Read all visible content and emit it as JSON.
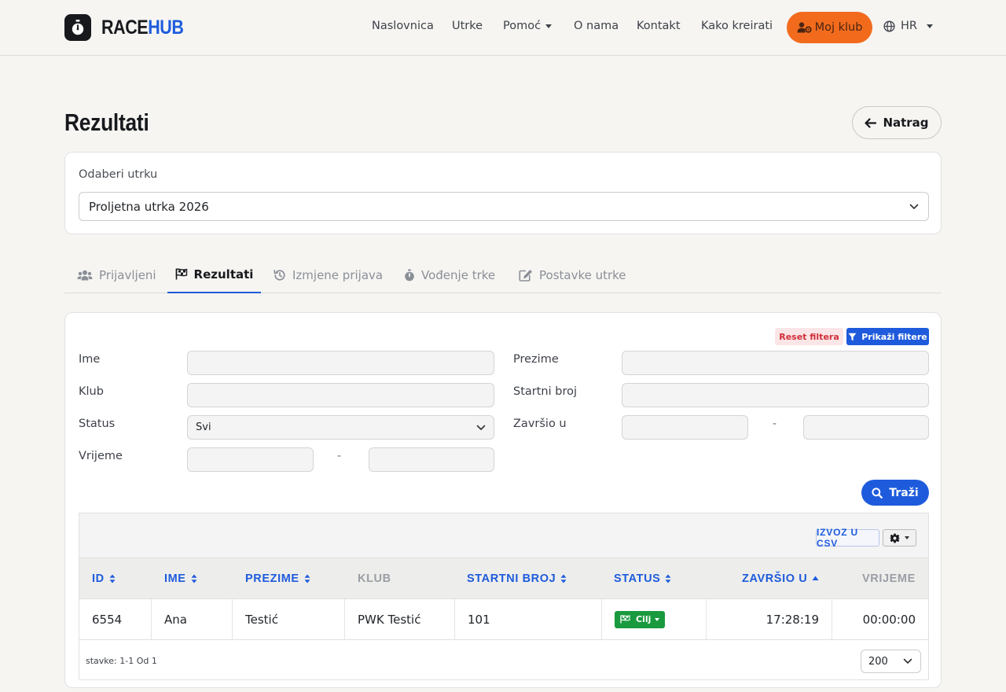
{
  "brand": {
    "part1": "RACE",
    "part2": "HUB"
  },
  "nav": {
    "items": [
      "Naslovnica",
      "Utrke",
      "Pomoć",
      "O nama",
      "Kontakt",
      "Kako kreirati"
    ],
    "club_button": "Moj klub",
    "language": "HR"
  },
  "header": {
    "title": "Rezultati",
    "back_label": "Natrag"
  },
  "race_select": {
    "label": "Odaberi utrku",
    "value": "Proljetna utrka 2026"
  },
  "tabs": [
    {
      "label": "Prijavljeni",
      "icon": "users-icon"
    },
    {
      "label": "Rezultati",
      "icon": "flag-checkered-icon",
      "active": true
    },
    {
      "label": "Izmjene prijava",
      "icon": "history-icon"
    },
    {
      "label": "Vođenje trke",
      "icon": "stopwatch-icon"
    },
    {
      "label": "Postavke utrke",
      "icon": "edit-icon"
    }
  ],
  "filters": {
    "reset_label": "Reset filtera",
    "show_label": "Prikaži filtere",
    "ime": "Ime",
    "prezime": "Prezime",
    "klub": "Klub",
    "startni_broj": "Startni broj",
    "status": "Status",
    "status_value": "Svi",
    "zavrsio": "Završio u",
    "vrijeme": "Vrijeme",
    "range_separator": "-",
    "search_label": "Traži"
  },
  "table": {
    "csv_label": "IZVOZ U CSV",
    "columns": [
      "ID",
      "IME",
      "PREZIME",
      "KLUB",
      "STARTNI BROJ",
      "STATUS",
      "ZAVRŠIO U",
      "VRIJEME"
    ],
    "rows": [
      {
        "id": "6554",
        "ime": "Ana",
        "prezime": "Testić",
        "klub": "PWK Testić",
        "startni_broj": "101",
        "status": "Cilj",
        "zavrsio": "17:28:19",
        "vrijeme": "00:00:00"
      }
    ],
    "page_info": "stavke: 1-1 Od 1",
    "page_size": "200"
  },
  "colors": {
    "accent": "#1e5bdc",
    "club": "#f26b1d",
    "success": "#1a9a3e",
    "danger": "#d0303a"
  }
}
